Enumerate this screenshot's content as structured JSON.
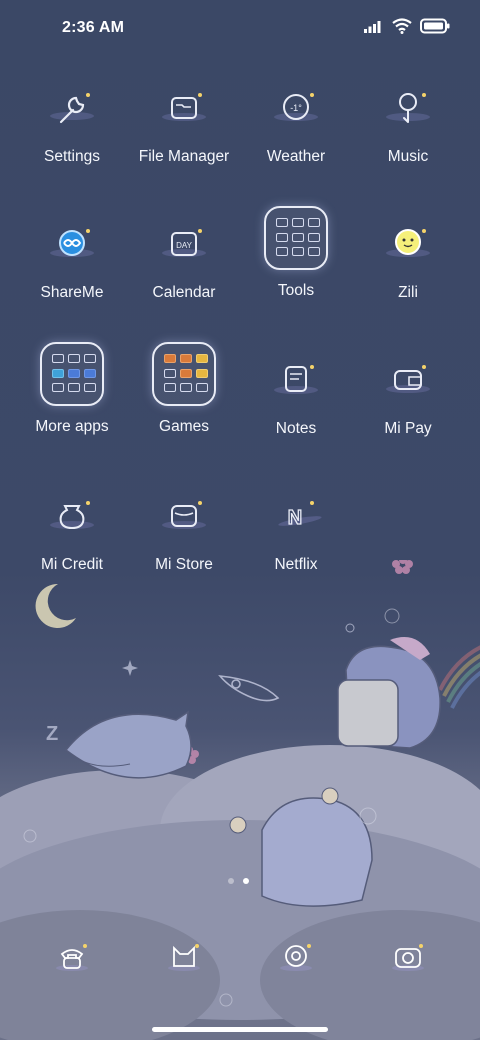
{
  "status_bar": {
    "time": "2:36 AM"
  },
  "apps": [
    {
      "label": "Settings",
      "icon": "wrench-icon"
    },
    {
      "label": "File Manager",
      "icon": "folder-icon"
    },
    {
      "label": "Weather",
      "icon": "weather-icon"
    },
    {
      "label": "Music",
      "icon": "music-icon"
    },
    {
      "label": "ShareMe",
      "icon": "shareme-icon"
    },
    {
      "label": "Calendar",
      "icon": "calendar-icon"
    },
    {
      "label": "Tools",
      "icon": "folder-tools-icon"
    },
    {
      "label": "Zili",
      "icon": "zili-icon"
    },
    {
      "label": "More apps",
      "icon": "folder-more-apps-icon"
    },
    {
      "label": "Games",
      "icon": "folder-games-icon"
    },
    {
      "label": "Notes",
      "icon": "notes-icon"
    },
    {
      "label": "Mi Pay",
      "icon": "wallet-icon"
    },
    {
      "label": "Mi Credit",
      "icon": "credit-icon"
    },
    {
      "label": "Mi Store",
      "icon": "store-icon"
    },
    {
      "label": "Netflix",
      "icon": "netflix-icon"
    }
  ],
  "calendar_icon_text": "DAY",
  "weather_icon_text": "-1°",
  "netflix_icon_text": "N",
  "dock": [
    {
      "icon": "phone-icon"
    },
    {
      "icon": "messages-icon"
    },
    {
      "icon": "browser-icon"
    },
    {
      "icon": "camera-icon"
    }
  ],
  "page_indicator": {
    "pages": 2,
    "current": 2
  },
  "wallpaper_text": "Z",
  "colors": {
    "background": "#3b4866",
    "icon_stroke": "#e9ecf6",
    "accent_star": "#f5d36a"
  }
}
